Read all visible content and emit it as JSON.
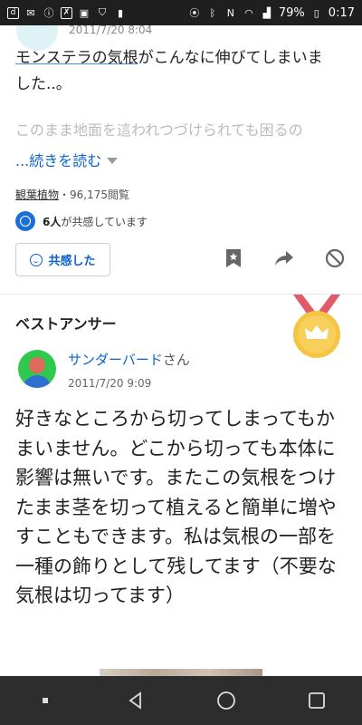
{
  "status_bar": {
    "battery_percent": "79%",
    "time": "0:17"
  },
  "previous": {
    "date": "2011/7/20 8:04"
  },
  "question": {
    "text_linked": "モンステラの気根",
    "text_rest_1": "がこんなに伸びてしまいま",
    "text_rest_2": "した..。",
    "faded_text": "このまま地面を這われつづけられても困るの",
    "read_more": "...続きを読む",
    "category": "観葉植物",
    "views": "・96,175閲覧",
    "empathy_count": "6人",
    "empathy_suffix": "が共感しています",
    "empathy_button": "共感した"
  },
  "best_answer": {
    "title": "ベストアンサー",
    "name": "サンダーバード",
    "honorific": "さん",
    "date": "2011/7/20 9:09",
    "text": "好きなところから切ってしまってもかまいません。どこから切っても本体に影響は無いです。またこの気根をつけたまま茎を切って植えると簡単に増やすこともできます。私は気根の一部を一種の飾りとして残してます（不要な気根は切ってます）"
  },
  "colors": {
    "link": "#0b63c9",
    "nav_bg": "#2d2d2d",
    "status_bg": "#1f1f1f",
    "medal": "#f4c542"
  }
}
